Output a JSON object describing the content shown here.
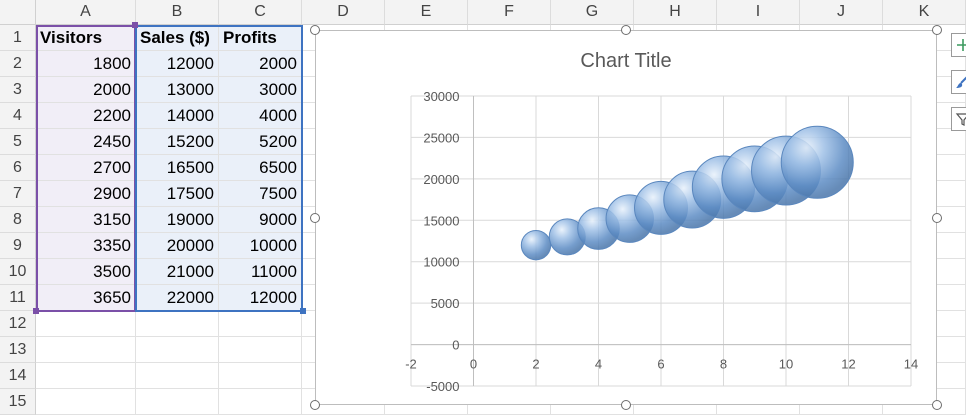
{
  "columns": [
    "A",
    "B",
    "C",
    "D",
    "E",
    "F",
    "G",
    "H",
    "I",
    "J",
    "K"
  ],
  "rows": [
    "1",
    "2",
    "3",
    "4",
    "5",
    "6",
    "7",
    "8",
    "9",
    "10",
    "11",
    "12",
    "13",
    "14",
    "15"
  ],
  "table": {
    "headers": [
      "Visitors",
      "Sales ($)",
      "Profits"
    ],
    "rows": [
      [
        "1800",
        "12000",
        "2000"
      ],
      [
        "2000",
        "13000",
        "3000"
      ],
      [
        "2200",
        "14000",
        "4000"
      ],
      [
        "2450",
        "15200",
        "5200"
      ],
      [
        "2700",
        "16500",
        "6500"
      ],
      [
        "2900",
        "17500",
        "7500"
      ],
      [
        "3150",
        "19000",
        "9000"
      ],
      [
        "3350",
        "20000",
        "10000"
      ],
      [
        "3500",
        "21000",
        "11000"
      ],
      [
        "3650",
        "22000",
        "12000"
      ]
    ]
  },
  "colors": {
    "bubble": "#6b9bd1",
    "grid": "#d9d9d9",
    "axis_text": "#595959",
    "title": "#595959",
    "select_purple": "#7b50a8",
    "select_blue": "#3e73c1",
    "chart_plus": "#3c9a5f",
    "chart_brush": "#3e73c1"
  },
  "side_buttons": [
    "plus-icon",
    "brush-icon",
    "filter-icon"
  ],
  "chart_data": {
    "type": "bubble",
    "title": "Chart Title",
    "xlabel": "",
    "ylabel": "",
    "xlim": [
      -2,
      14
    ],
    "ylim": [
      -5000,
      30000
    ],
    "x_ticks": [
      "-2",
      "0",
      "2",
      "4",
      "6",
      "8",
      "10",
      "12",
      "14"
    ],
    "y_ticks": [
      "30000",
      "25000",
      "20000",
      "15000",
      "10000",
      "5000",
      "0",
      "-5000"
    ],
    "x": [
      2,
      3,
      4,
      5,
      6,
      7,
      8,
      9,
      10,
      11
    ],
    "y": [
      12000,
      13000,
      14000,
      15200,
      16500,
      17500,
      19000,
      20000,
      21000,
      22000
    ],
    "size": [
      2000,
      3000,
      4000,
      5200,
      6500,
      7500,
      9000,
      10000,
      11000,
      12000
    ],
    "grid": true,
    "legend": "none"
  }
}
